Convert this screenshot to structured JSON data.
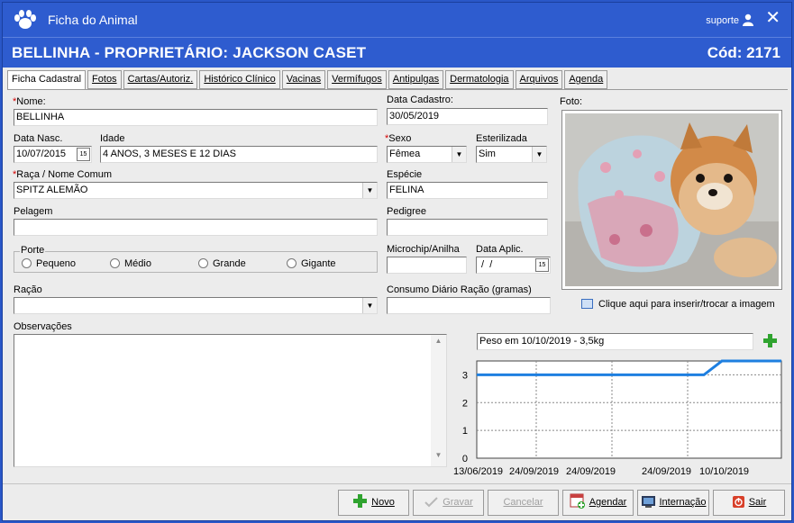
{
  "window": {
    "title": "Ficha do Animal",
    "user": "suporte",
    "close": "✕"
  },
  "header": {
    "title": "BELLINHA - PROPRIETÁRIO: JACKSON CASET",
    "code": "Cód: 2171"
  },
  "tabs": [
    "Ficha Cadastral",
    "Fotos",
    "Cartas/Autoriz.",
    "Histórico Clínico",
    "Vacinas",
    "Vermífugos",
    "Antipulgas",
    "Dermatologia",
    "Arquivos",
    "Agenda"
  ],
  "form": {
    "nome_label": "Nome:",
    "nome": "BELLINHA",
    "data_cadastro_label": "Data Cadastro:",
    "data_cadastro": "30/05/2019",
    "data_nasc_label": "Data Nasc.",
    "data_nasc": "10/07/2015",
    "idade_label": "Idade",
    "idade": "4 ANOS, 3 MESES E 12 DIAS",
    "sexo_label": "Sexo",
    "sexo": "Fêmea",
    "esterilizada_label": "Esterilizada",
    "esterilizada": "Sim",
    "raca_label": "Raça / Nome Comum",
    "raca": "SPITZ ALEMÃO",
    "especie_label": "Espécie",
    "especie": "FELINA",
    "pelagem_label": "Pelagem",
    "pelagem": "",
    "pedigree_label": "Pedigree",
    "pedigree": "",
    "porte_label": "Porte",
    "porte_options": [
      "Pequeno",
      "Médio",
      "Grande",
      "Gigante"
    ],
    "microchip_label": "Microchip/Anilha",
    "microchip": "",
    "data_aplic_label": "Data Aplic.",
    "data_aplic": " /  /",
    "racao_label": "Ração",
    "racao": "",
    "consumo_label": "Consumo Diário Ração (gramas)",
    "consumo": "",
    "observacoes_label": "Observações",
    "foto_label": "Foto:",
    "foto_link": "Clique aqui para inserir/trocar a imagem",
    "peso": "Peso em 10/10/2019  -  3,5kg"
  },
  "chart_data": {
    "type": "line",
    "x": [
      "13/06/2019",
      "24/09/2019",
      "24/09/2019",
      "24/09/2019",
      "10/10/2019"
    ],
    "series": [
      {
        "values": [
          3,
          3,
          3,
          3,
          3.5
        ]
      }
    ],
    "yticks": [
      0,
      1,
      2,
      3
    ],
    "ylim": [
      0,
      3.5
    ],
    "grid": true,
    "colors": {
      "line": "#1e7fe0"
    }
  },
  "buttons": {
    "novo": "Novo",
    "gravar": "Gravar",
    "cancelar": "Cancelar",
    "agendar": "Agendar",
    "internacao": "Internação",
    "sair": "Sair"
  }
}
